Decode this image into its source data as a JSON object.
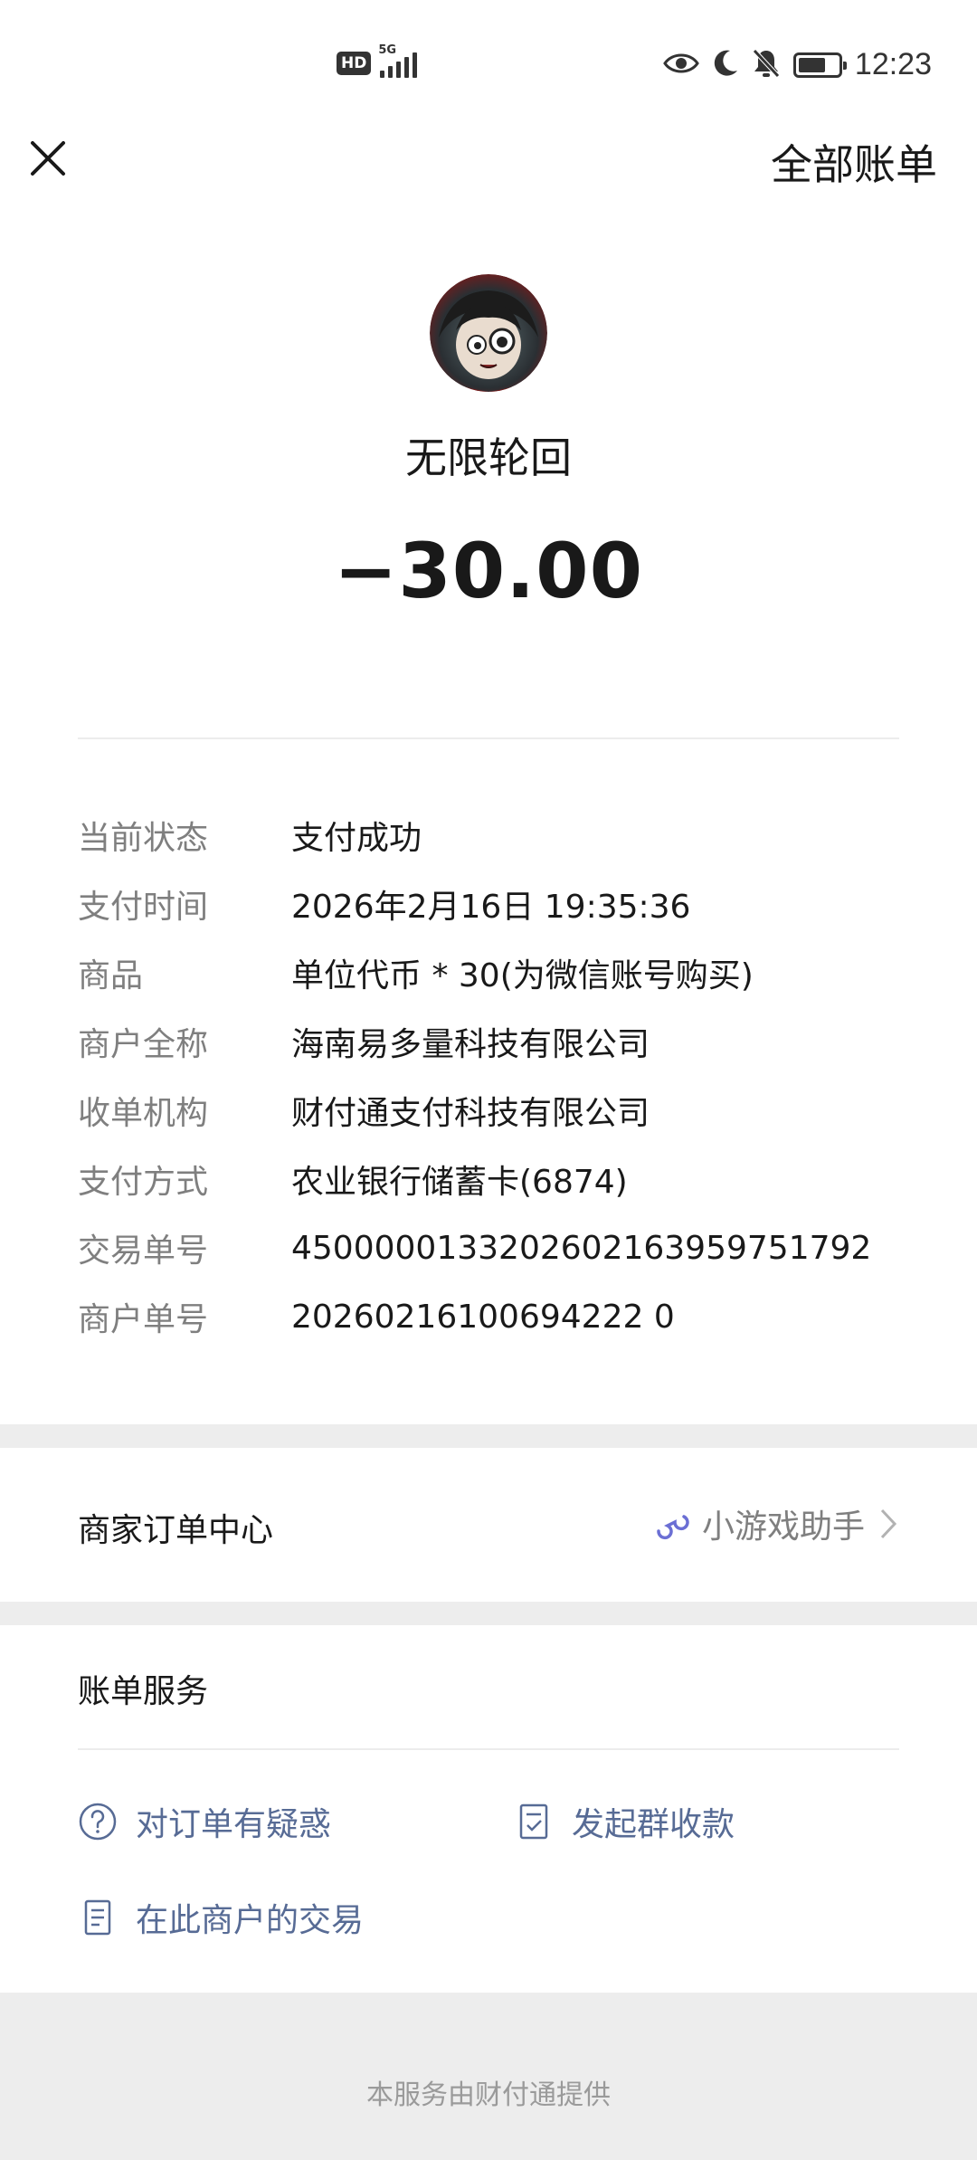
{
  "status_bar": {
    "hd_label": "HD",
    "network_label": "5G",
    "time": "12:23",
    "battery_level": 0.7,
    "icons": [
      "eye-icon",
      "moon-icon",
      "bell-off-icon",
      "battery-icon"
    ]
  },
  "header": {
    "close_icon": "close-icon",
    "all_bills_label": "全部账单"
  },
  "merchant": {
    "avatar_icon": "avatar-icon",
    "name": "无限轮回",
    "amount": "−30.00"
  },
  "details": [
    {
      "label": "当前状态",
      "value": "支付成功"
    },
    {
      "label": "支付时间",
      "value": "2026年2月16日 19:35:36"
    },
    {
      "label": "商品",
      "value": "单位代币 * 30(为微信账号购买)"
    },
    {
      "label": "商户全称",
      "value": "海南易多量科技有限公司"
    },
    {
      "label": "收单机构",
      "value": "财付通支付科技有限公司"
    },
    {
      "label": "支付方式",
      "value": "农业银行储蓄卡(6874)"
    },
    {
      "label": "交易单号",
      "value": "4500000133202602163959751792"
    },
    {
      "label": "商户单号",
      "value": "20260216100694222 0"
    }
  ],
  "order_center": {
    "label": "商家订单中心",
    "link_icon": "mini-program-icon",
    "link_label": "小游戏助手",
    "chevron_icon": "chevron-right-icon"
  },
  "bill_service": {
    "title": "账单服务",
    "actions": [
      {
        "icon": "question-circle-icon",
        "label": "对订单有疑惑"
      },
      {
        "icon": "group-collect-icon",
        "label": "发起群收款"
      },
      {
        "icon": "document-icon",
        "label": "在此商户的交易"
      }
    ]
  },
  "footer": {
    "text": "本服务由财付通提供"
  },
  "colors": {
    "link": "#576b95",
    "label_gray": "#7f7f7f",
    "text": "#191919",
    "divider_band": "#ededed",
    "mini_program": "#6b6fd4"
  }
}
